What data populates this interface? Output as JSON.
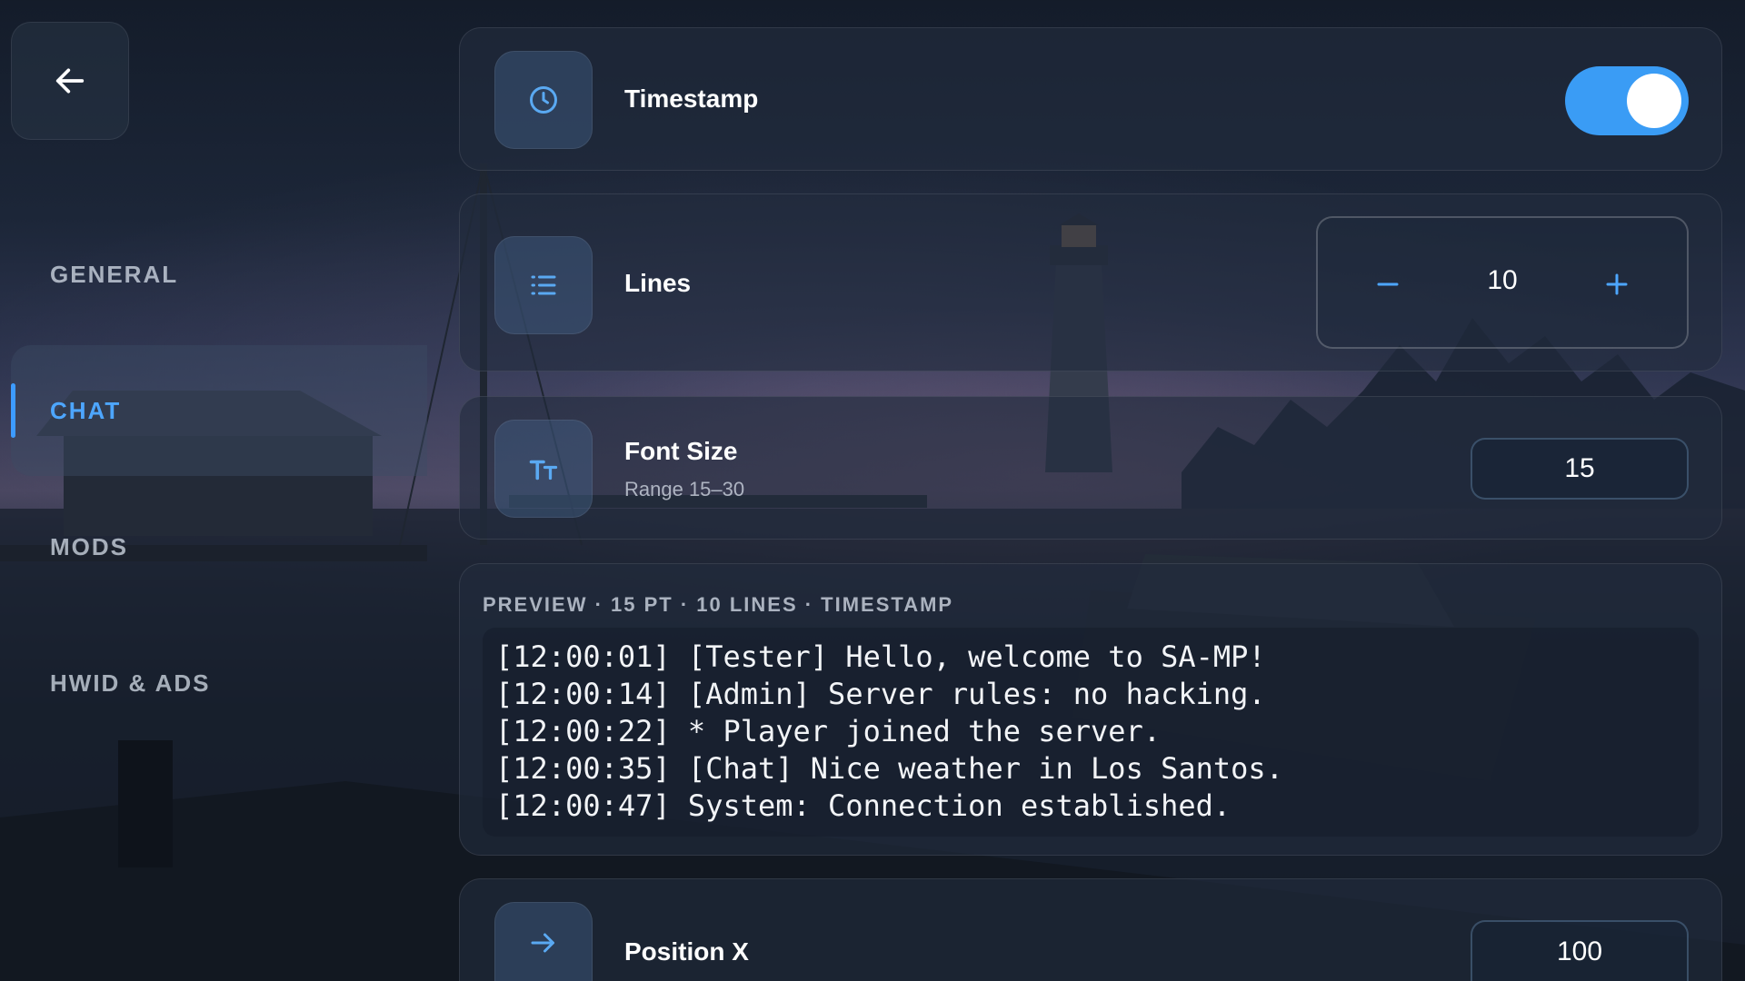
{
  "sidebar": {
    "back_icon": "arrow-left-icon",
    "items": [
      {
        "label": "GENERAL",
        "active": false
      },
      {
        "label": "CHAT",
        "active": true
      },
      {
        "label": "MODS",
        "active": false
      },
      {
        "label": "HWID & ADS",
        "active": false
      }
    ]
  },
  "settings": {
    "timestamp": {
      "label": "Timestamp",
      "icon": "clock-icon",
      "enabled": true
    },
    "lines": {
      "label": "Lines",
      "icon": "list-icon",
      "value": "10"
    },
    "font_size": {
      "label": "Font Size",
      "sub": "Range 15–30",
      "icon": "text-size-icon",
      "value": "15"
    },
    "position_x": {
      "label": "Position X",
      "icon": "arrow-right-icon",
      "value": "100"
    }
  },
  "preview": {
    "title": "PREVIEW · 15 PT · 10 LINES · TIMESTAMP",
    "lines": [
      "[12:00:01] [Tester] Hello, welcome to SA-MP!",
      "[12:00:14] [Admin] Server rules: no hacking.",
      "[12:00:22] * Player joined the server.",
      "[12:00:35] [Chat] Nice weather in Los Santos.",
      "[12:00:47] System: Connection established."
    ]
  },
  "colors": {
    "accent": "#3a9cf5",
    "active_nav": "#4da6ff",
    "icon": "#5aa9f2"
  }
}
